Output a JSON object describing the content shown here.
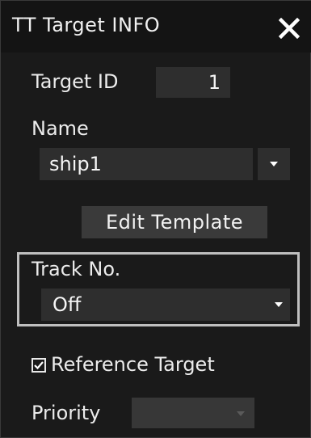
{
  "window": {
    "title": "TT Target INFO",
    "close_icon": "close-icon"
  },
  "target_id": {
    "label": "Target ID",
    "value": "1"
  },
  "name": {
    "label": "Name",
    "value": "ship1",
    "arrow_icon": "dropdown-arrow-icon"
  },
  "edit_template": {
    "label": "Edit Template"
  },
  "track_no": {
    "label": "Track No.",
    "value": "Off",
    "arrow_icon": "dropdown-arrow-icon"
  },
  "reference_target": {
    "label": "Reference Target",
    "checked": true
  },
  "priority": {
    "label": "Priority",
    "value": "",
    "enabled": false
  },
  "colors": {
    "background": "#1a1a1a",
    "field": "#2e2e2e",
    "button": "#3a3a3a",
    "group_border": "#bfbfbf",
    "text": "#ececec"
  }
}
